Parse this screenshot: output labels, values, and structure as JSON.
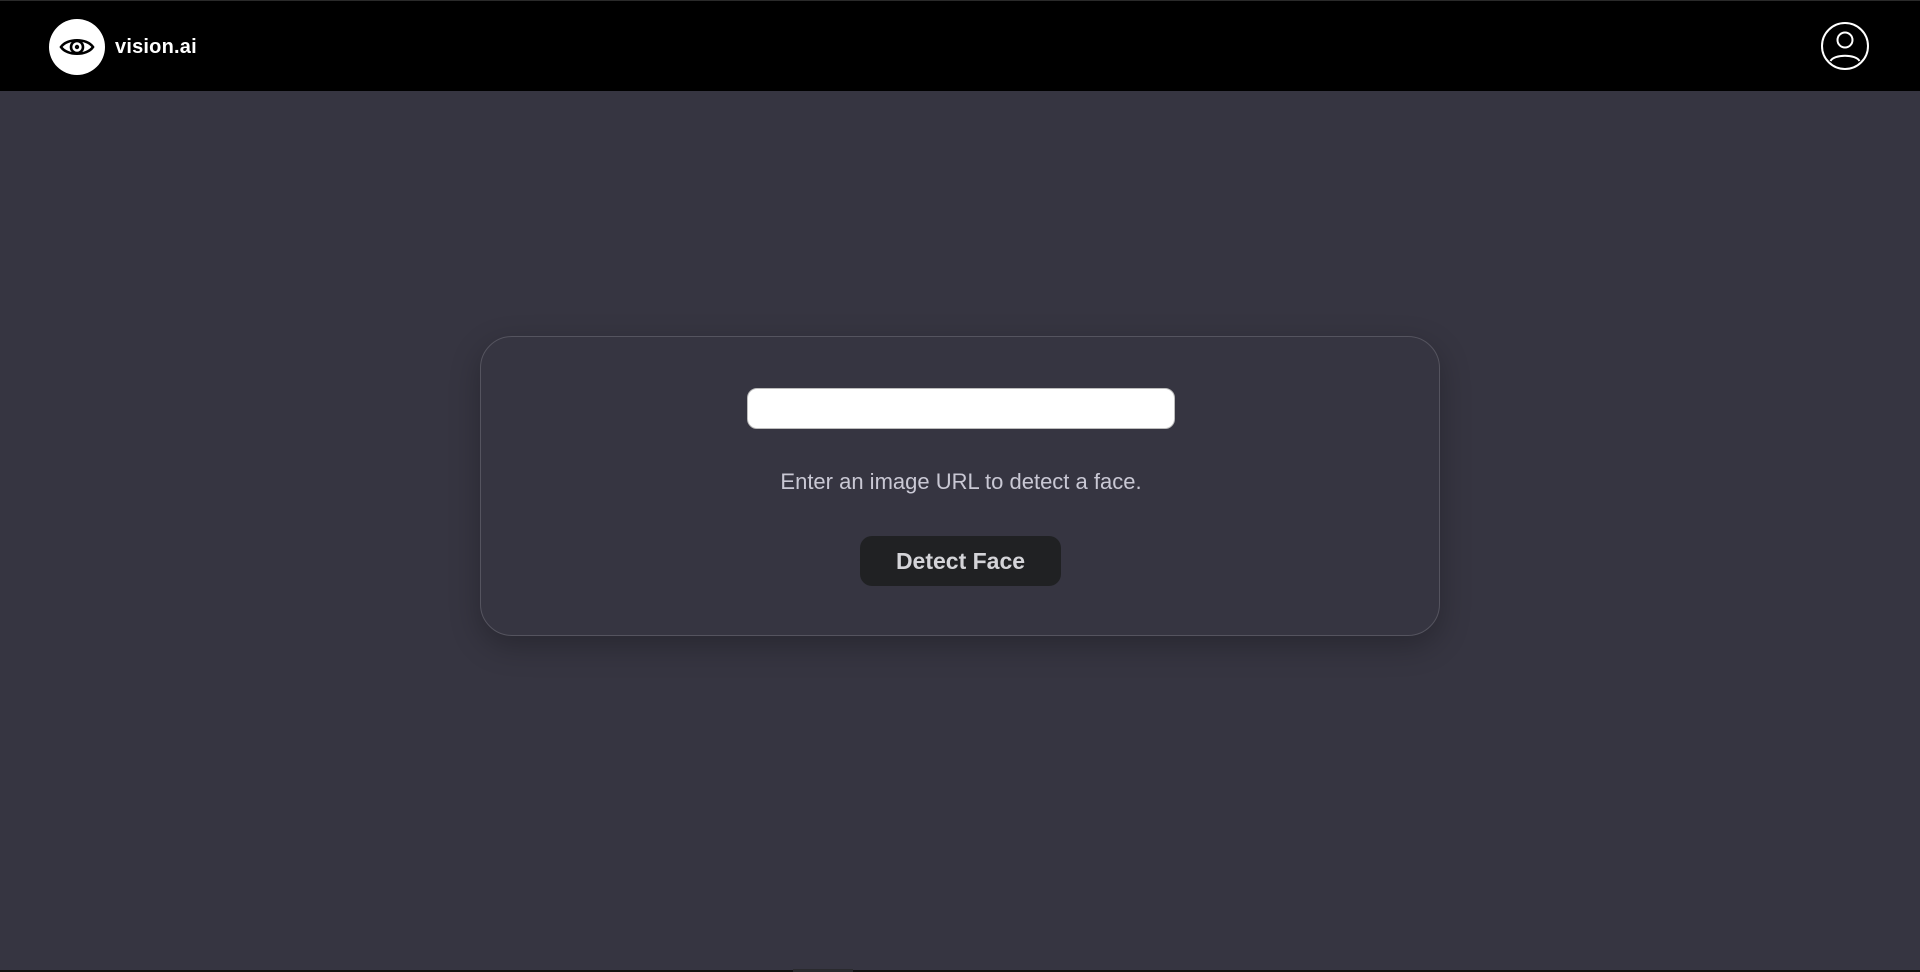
{
  "navbar": {
    "brand_name": "vision.ai",
    "logo_icon": "eye-icon",
    "profile_icon": "user-circle-icon"
  },
  "form": {
    "url_input_value": "",
    "url_input_placeholder": "",
    "hint_text": "Enter an image URL to detect a face.",
    "detect_button_label": "Detect Face"
  },
  "colors": {
    "background": "#363541",
    "navbar": "#000000",
    "button_bg": "#202123",
    "button_text": "#d4d4d8",
    "hint_text": "#c9c8d4"
  }
}
